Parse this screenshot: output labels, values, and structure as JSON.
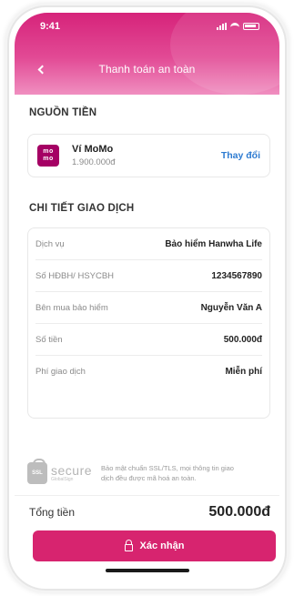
{
  "status_bar": {
    "time": "9:41"
  },
  "header": {
    "title": "Thanh toán an toàn"
  },
  "source": {
    "section_title": "NGUỒN TIỀN",
    "wallet_logo_text": [
      "mo",
      "mo"
    ],
    "wallet_name": "Ví MoMo",
    "wallet_balance": "1.900.000đ",
    "change_label": "Thay đổi"
  },
  "details": {
    "section_title": "CHI TIẾT GIAO DỊCH",
    "rows": [
      {
        "label": "Dịch vụ",
        "value": "Bảo hiểm Hanwha Life"
      },
      {
        "label": "Số HĐBH/ HSYCBH",
        "value": "1234567890"
      },
      {
        "label": "Bên mua bảo hiểm",
        "value": "Nguyễn Văn A"
      },
      {
        "label": "Số tiền",
        "value": "500.000đ"
      },
      {
        "label": "Phí giao dịch",
        "value": "Miễn phí"
      }
    ]
  },
  "security": {
    "badge_text": "SSL",
    "secure_word": "secure",
    "secure_sub": "GlobalSign",
    "note": "Bảo mật chuẩn SSL/TLS, mọi thông tin giao dịch đều được mã hoá an toàn."
  },
  "total": {
    "label": "Tổng tiền",
    "value": "500.000đ"
  },
  "confirm_button": {
    "label": "Xác nhận"
  },
  "colors": {
    "brand": "#d7246f",
    "link": "#2d7bd1",
    "momo": "#a50064"
  }
}
